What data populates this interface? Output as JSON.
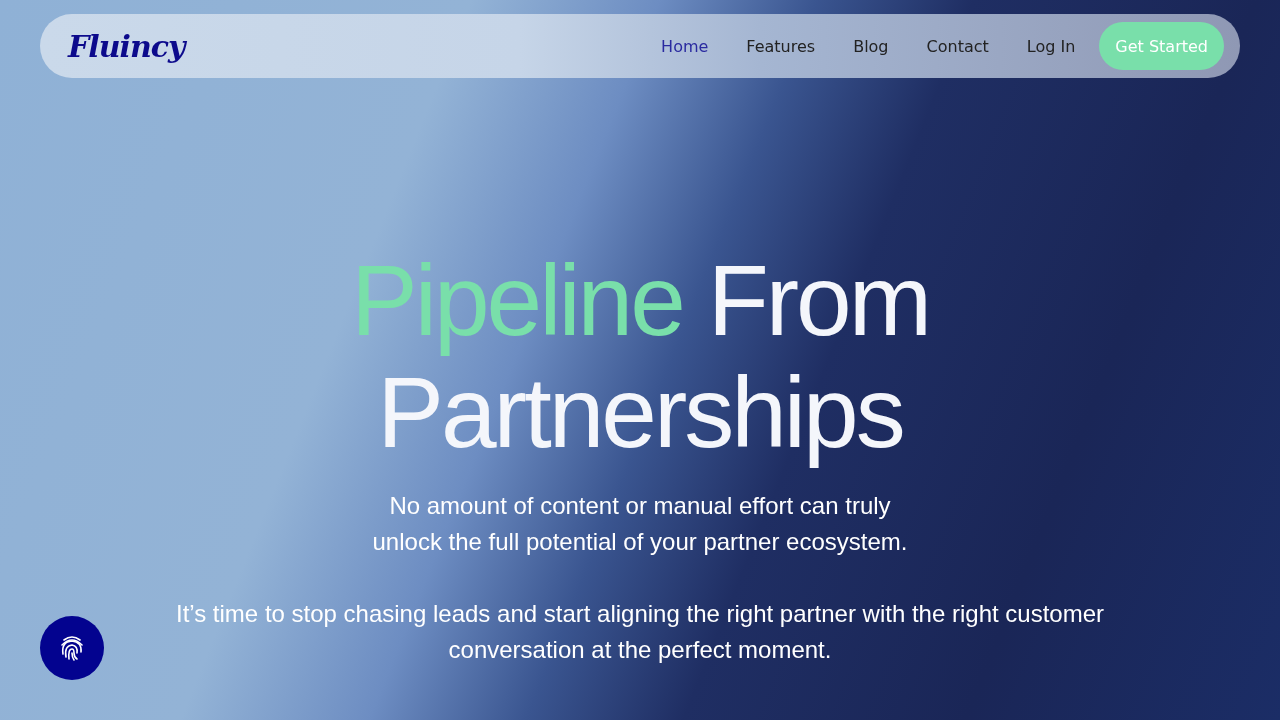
{
  "nav": {
    "logo": "Fluincy",
    "links": [
      {
        "label": "Home",
        "selected": true
      },
      {
        "label": "Features",
        "selected": false
      },
      {
        "label": "Blog",
        "selected": false
      },
      {
        "label": "Contact",
        "selected": false
      },
      {
        "label": "Log In",
        "selected": false
      }
    ],
    "cta": "Get Started"
  },
  "hero": {
    "headline": [
      {
        "text": "Pipeline",
        "kind": "accent"
      },
      {
        "text": "From Partnerships",
        "kind": "plain"
      }
    ],
    "paragraphs": [
      "No amount of content or manual effort can truly unlock the full potential of your partner ecosystem.",
      "It’s time to stop chasing leads and start aligning the right partner with the right customer conversation at the perfect moment."
    ]
  }
}
